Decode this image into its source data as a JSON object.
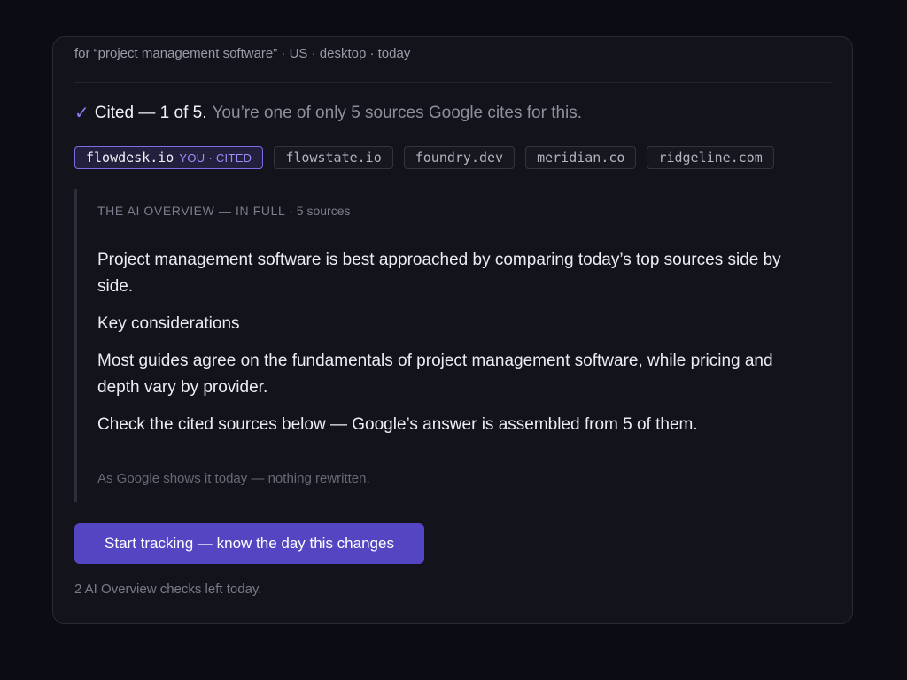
{
  "query_line": "for “project management software” · US · desktop · today",
  "status": {
    "check_icon": "check-icon",
    "strong": "Cited — 1 of 5.",
    "message": "You’re one of only 5 sources Google cites for this."
  },
  "sources": [
    {
      "domain": "flowdesk.io",
      "tag": "YOU · CITED",
      "active": true
    },
    {
      "domain": "flowstate.io",
      "tag": "",
      "active": false
    },
    {
      "domain": "foundry.dev",
      "tag": "",
      "active": false
    },
    {
      "domain": "meridian.co",
      "tag": "",
      "active": false
    },
    {
      "domain": "ridgeline.com",
      "tag": "",
      "active": false
    }
  ],
  "overview": {
    "heading": "THE AI OVERVIEW — IN FULL",
    "source_count": "5 sources",
    "paragraphs": [
      "Project management software is best approached by comparing today’s top sources side by side.",
      "Key considerations",
      "Most guides agree on the fundamentals of project management software, while pricing and depth vary by provider.",
      "Check the cited sources below — Google’s answer is assembled from 5 of them."
    ],
    "footnote": "As Google shows it today — nothing rewritten."
  },
  "cta": {
    "label": "Start tracking — know the day this changes"
  },
  "remaining": "2 AI Overview checks left today.",
  "colors": {
    "accent": "#5446c2",
    "check": "#8b7cf6",
    "background": "#0c0c15",
    "card": "#13131c"
  }
}
